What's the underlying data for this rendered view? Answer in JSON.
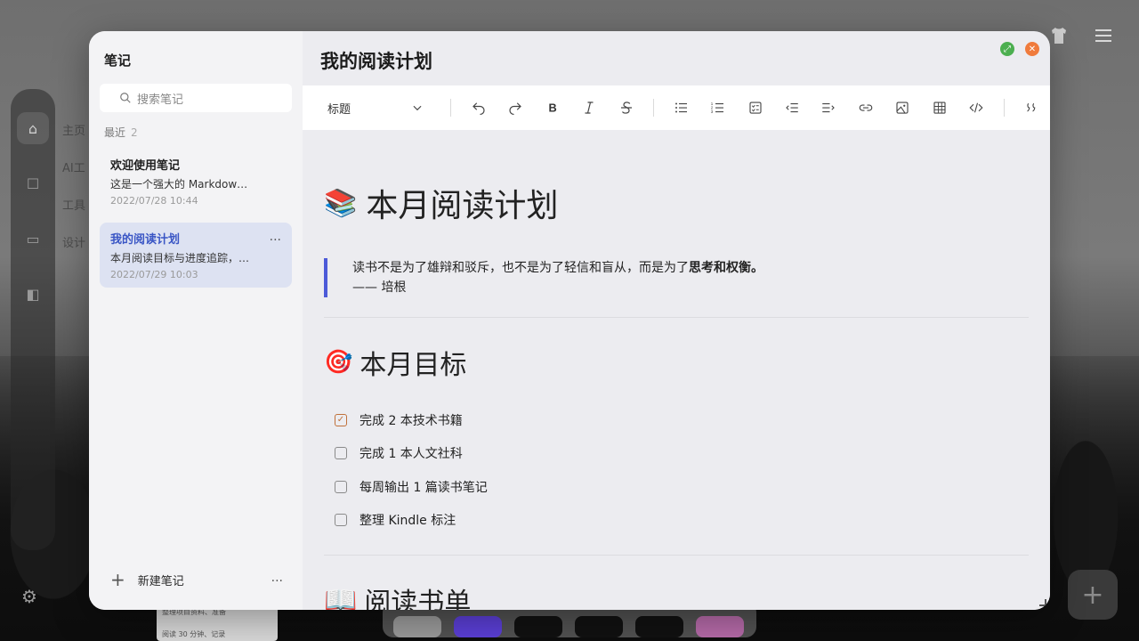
{
  "desktop": {
    "background_labels": [
      "主页",
      "AI工",
      "工具",
      "设计"
    ],
    "dock_card_lines": [
      "整理项目资料、准备",
      "阅读 30 分钟、记录"
    ]
  },
  "window": {
    "sidebar": {
      "title": "笔记",
      "search_placeholder": "搜索笔记",
      "section_label": "最近",
      "section_count": "2",
      "notes": [
        {
          "title": "欢迎使用笔记",
          "preview": "这是一个强大的 Markdow…",
          "date": "2022/07/28 10:44"
        },
        {
          "title": "我的阅读计划",
          "preview": "本月阅读目标与进度追踪，…",
          "date": "2022/07/29 10:03"
        }
      ],
      "new_note_label": "新建笔记"
    },
    "doc_title": "我的阅读计划",
    "toolbar": {
      "heading_select": "标题"
    },
    "editor": {
      "h1_emoji": "📚",
      "h1": "本月阅读计划",
      "quote_text": "读书不是为了雄辩和驳斥，也不是为了轻信和盲从，而是为了",
      "quote_bold": "思考和权衡。",
      "quote_author": "—— 培根",
      "h2_emoji": "🎯",
      "h2": "本月目标",
      "tasks": [
        {
          "label": "完成 2 本技术书籍",
          "checked": true
        },
        {
          "label": "完成 1 本人文社科",
          "checked": false
        },
        {
          "label": "每周输出 1 篇读书笔记",
          "checked": false
        },
        {
          "label": "整理 Kindle 标注",
          "checked": false
        }
      ],
      "h2b_emoji": "📖",
      "h2b": "阅读书单"
    }
  }
}
